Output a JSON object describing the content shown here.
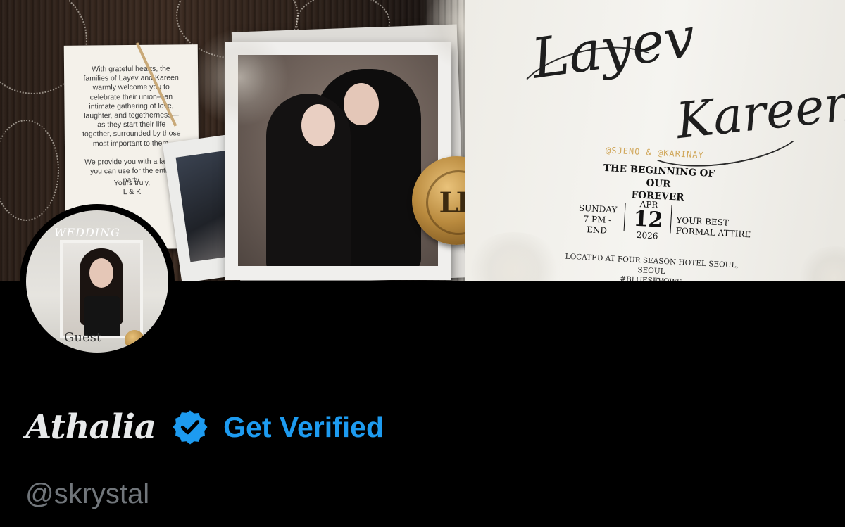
{
  "banner": {
    "note_body": "With grateful hearts, the\nfamilies of Layev and Kareen\nwarmly welcome you to\ncelebrate their union—an\nintimate gathering of love,\nlaughter, and togetherness—\nas they start their life\ntogether, surrounded by those\nmost important to them.\n\nWe provide you with a layout\nyou can use for the entire\nparty.",
    "note_sign": "Yours truly,\nL & K",
    "seal_monogram": "LK",
    "script_name_1": "Layev",
    "script_name_2": "Kareen",
    "handles": "@SJENO & @KARINAY",
    "tagline": "THE BEGINNING OF OUR\nFOREVER",
    "day_time": "SUNDAY\n7 PM - END",
    "month": "APR",
    "day": "12",
    "year": "2026",
    "dress_code": "YOUR BEST\nFORMAL ATTIRE",
    "location": "LOCATED AT FOUR SEASON HOTEL SEOUL, SEOUL\n#BLUESEVOWS"
  },
  "avatar": {
    "card_title": "WEDDING",
    "card_label": "Guest"
  },
  "profile": {
    "display_name": "Athalia",
    "verified_icon": "verified-badge-icon",
    "get_verified_label": "Get Verified",
    "handle": "@skrystal",
    "accent_color": "#1d9bf0"
  }
}
